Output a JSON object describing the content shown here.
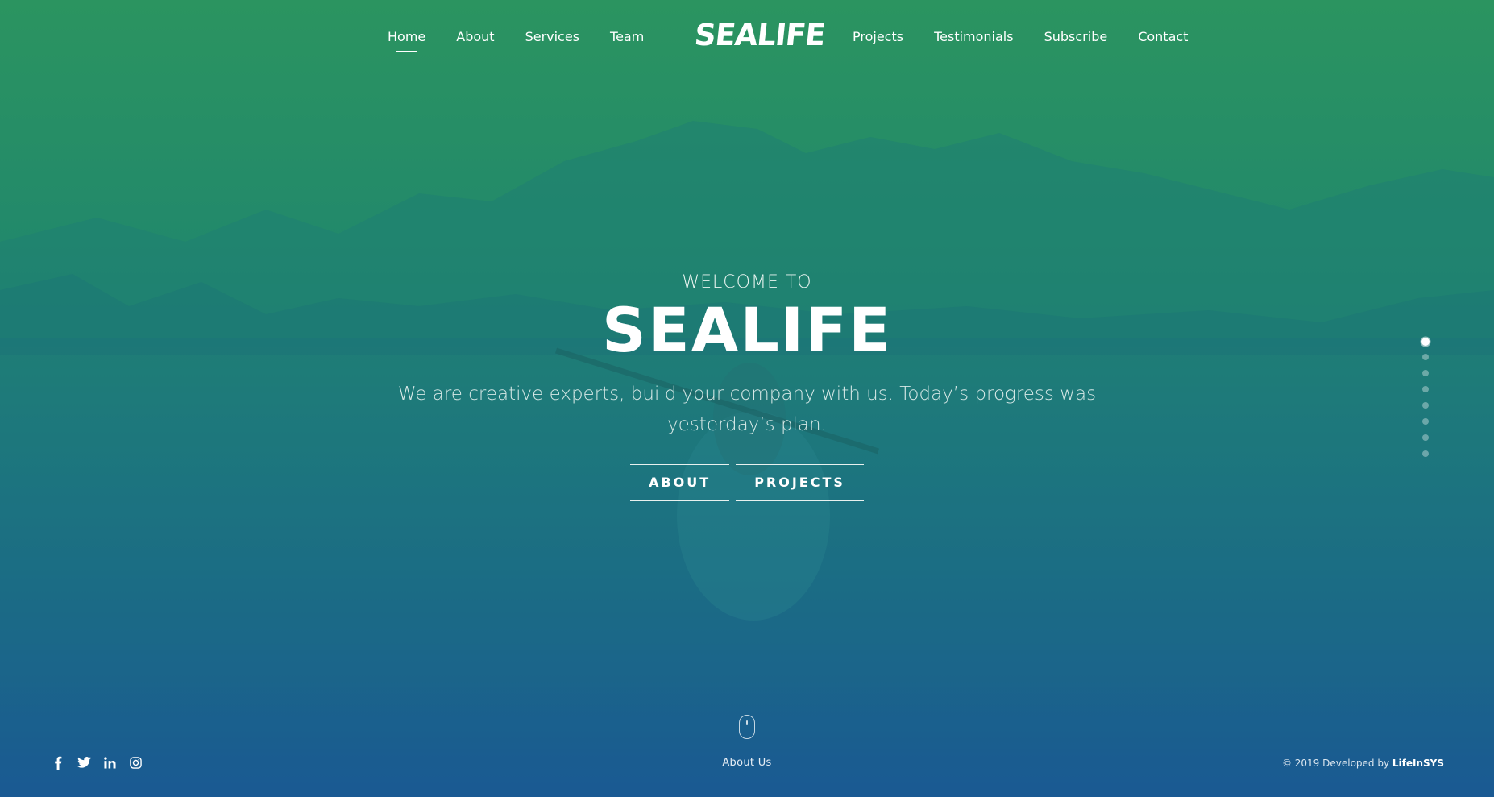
{
  "colors": {
    "gradient_top": "#2a9262",
    "gradient_bottom": "#1a5a95",
    "text": "#ffffff"
  },
  "nav": {
    "left_items": [
      {
        "label": "Home",
        "active": true
      },
      {
        "label": "About"
      },
      {
        "label": "Services"
      },
      {
        "label": "Team"
      }
    ],
    "logo": "SEALIFE",
    "right_items": [
      {
        "label": "Projects"
      },
      {
        "label": "Testimonials"
      },
      {
        "label": "Subscribe"
      },
      {
        "label": "Contact"
      }
    ]
  },
  "hero": {
    "kicker": "WELCOME TO",
    "title": "SEALIFE",
    "subtitle": "We are creative experts, build your company with us. Today’s progress was yesterday’s plan.",
    "buttons": [
      {
        "label": "ABOUT"
      },
      {
        "label": "PROJECTS"
      }
    ]
  },
  "side_nav": {
    "active_index": 0,
    "count": 8
  },
  "scroll": {
    "label": "About Us",
    "icon": "mouse-scroll-icon"
  },
  "footer": {
    "social": [
      {
        "icon": "facebook-icon"
      },
      {
        "icon": "twitter-icon"
      },
      {
        "icon": "linkedin-icon"
      },
      {
        "icon": "instagram-icon"
      }
    ],
    "copyright_prefix": "© 2019 Developed by",
    "copyright_brand": "LifeInSYS"
  }
}
